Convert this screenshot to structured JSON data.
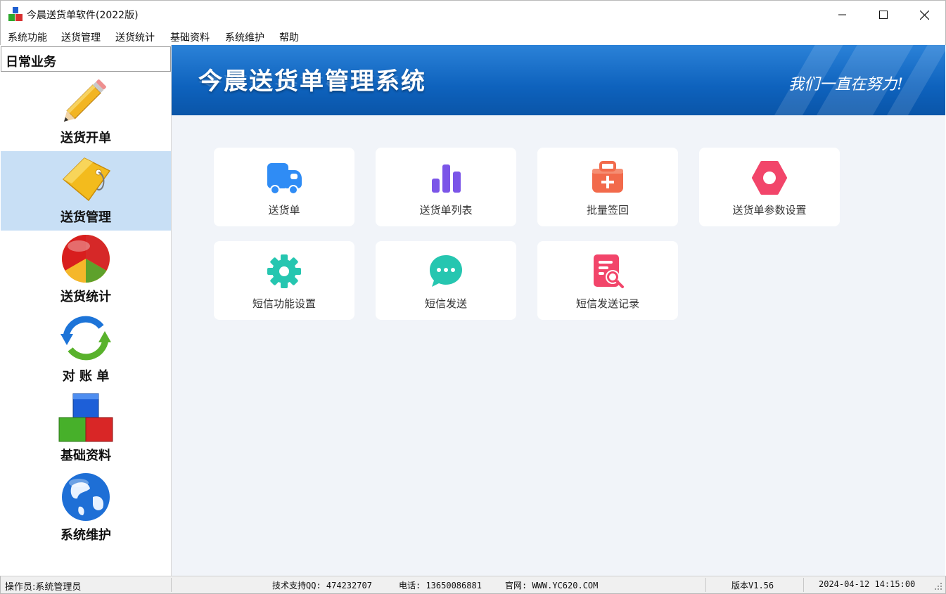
{
  "window": {
    "title": "今晨送货单软件(2022版)",
    "controls": [
      "minimize-icon",
      "maximize-icon",
      "close-icon"
    ]
  },
  "menu": [
    "系统功能",
    "送货管理",
    "送货统计",
    "基础资料",
    "系统维护",
    "帮助"
  ],
  "sidebar": {
    "header": "日常业务",
    "items": [
      {
        "label": "送货开单",
        "icon": "pencil-icon"
      },
      {
        "label": "送货管理",
        "icon": "tag-icon",
        "active": true
      },
      {
        "label": "送货统计",
        "icon": "pie-chart-icon"
      },
      {
        "label": "对 账 单",
        "icon": "refresh-arrows-icon"
      },
      {
        "label": "基础资料",
        "icon": "blocks-icon"
      },
      {
        "label": "系统维护",
        "icon": "globe-icon"
      }
    ]
  },
  "banner": {
    "title": "今晨送货单管理系统",
    "slogan": "我们一直在努力!"
  },
  "cards": [
    {
      "label": "送货单",
      "icon": "truck-icon",
      "color": "#2f8cf5"
    },
    {
      "label": "送货单列表",
      "icon": "bar-chart-icon",
      "color": "#7b55e8"
    },
    {
      "label": "批量签回",
      "icon": "medkit-icon",
      "color": "#f26a4b"
    },
    {
      "label": "送货单参数设置",
      "icon": "hexagon-nut-icon",
      "color": "#f2456a"
    },
    {
      "label": "短信功能设置",
      "icon": "gear-icon",
      "color": "#26c6b0"
    },
    {
      "label": "短信发送",
      "icon": "chat-bubble-icon",
      "color": "#26c6b0"
    },
    {
      "label": "短信发送记录",
      "icon": "document-search-icon",
      "color": "#f2456a"
    }
  ],
  "status": {
    "operator": "操作员:系统管理员",
    "support_qq": "技术支持QQ: 474232707",
    "phone": "电话: 13650086881",
    "website": "官网: WWW.YC620.COM",
    "version": "版本V1.56",
    "datetime": "2024-04-12 14:15:00"
  }
}
